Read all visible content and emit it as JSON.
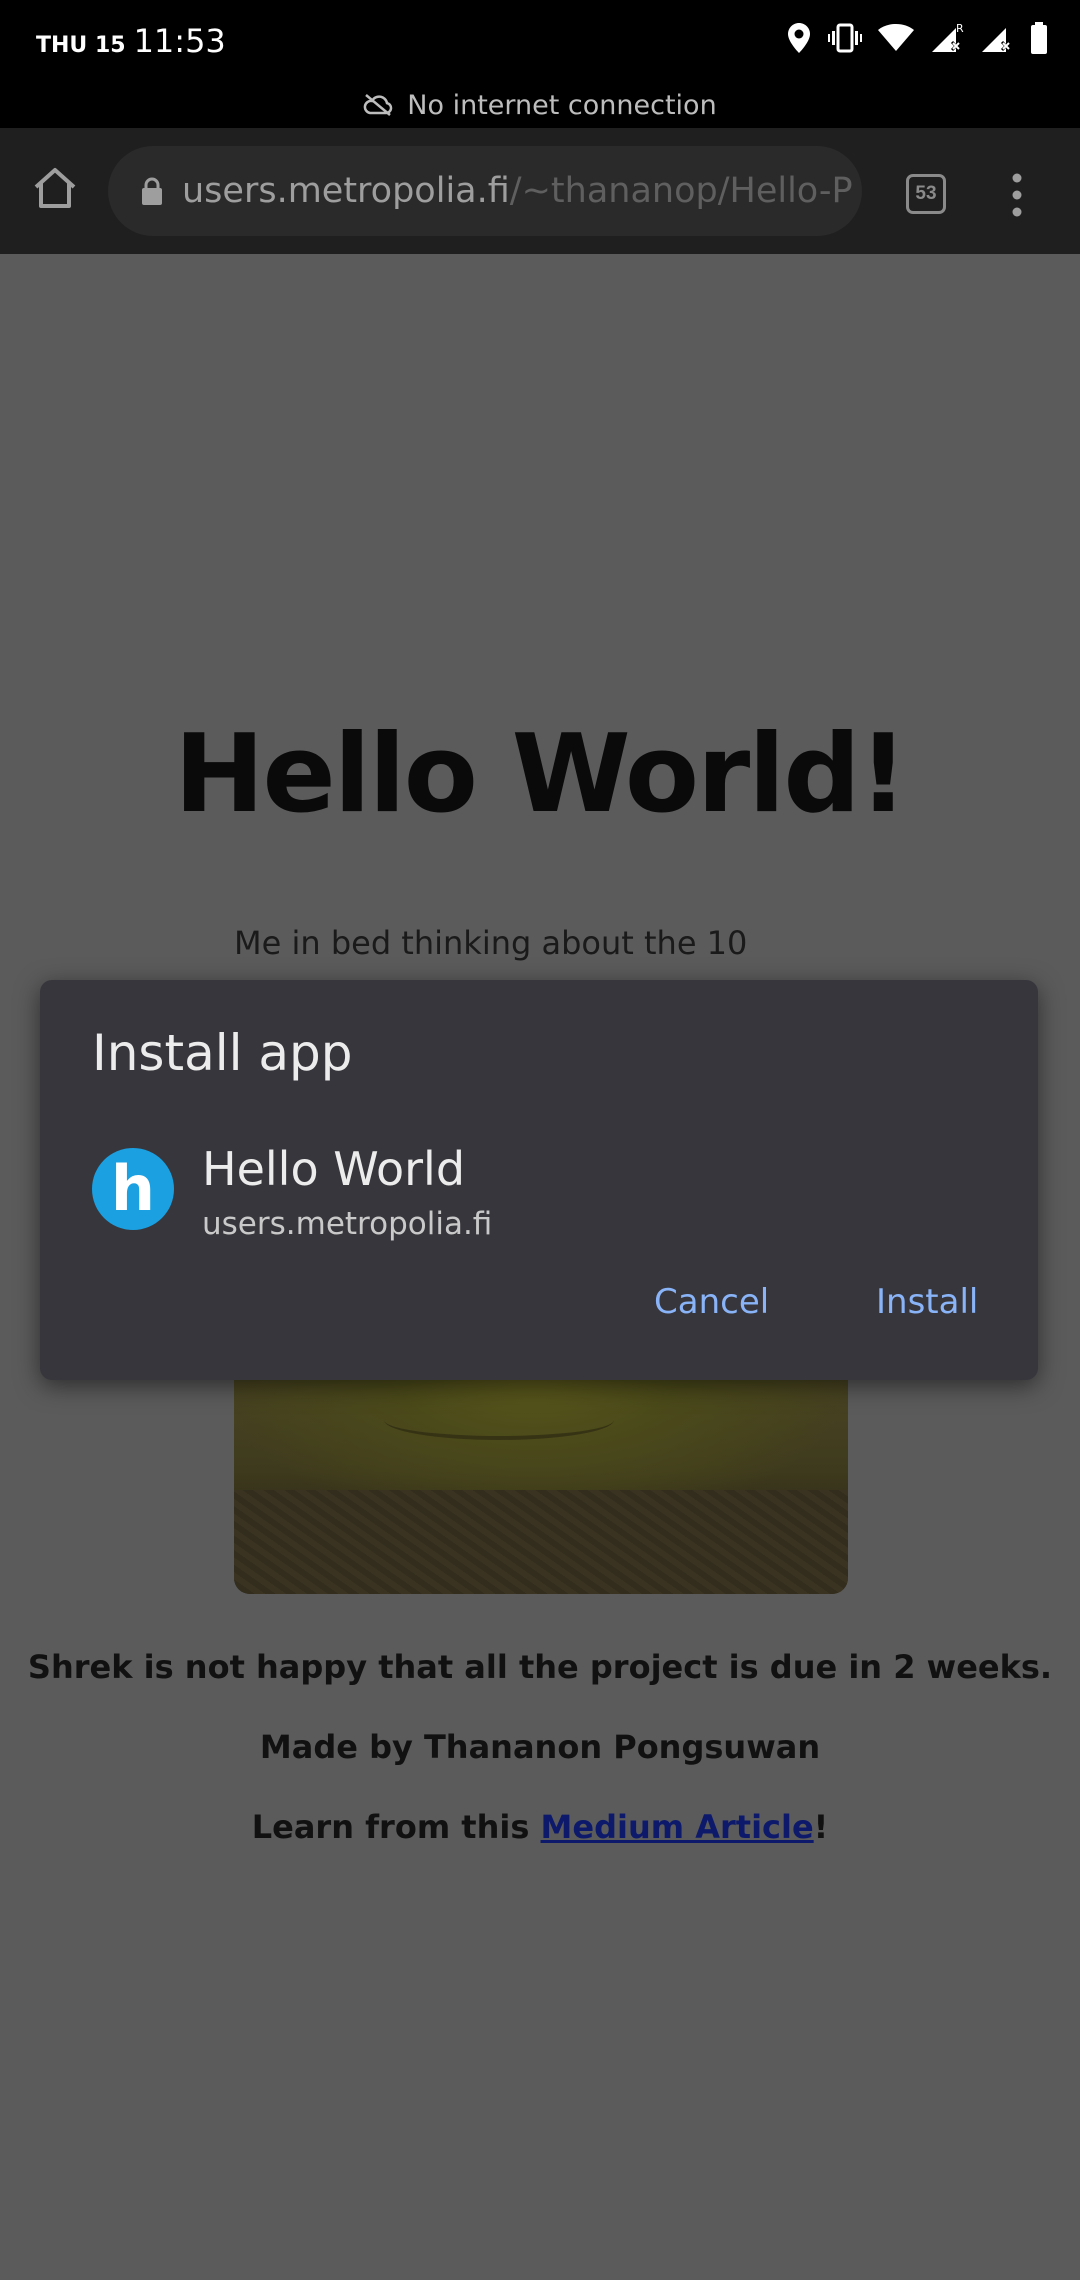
{
  "status_bar": {
    "day": "THU 15",
    "time": "11:53"
  },
  "offline_banner": {
    "text": "No internet connection",
    "icon": "cloud-off-icon"
  },
  "toolbar": {
    "home_icon": "home-icon",
    "lock_icon": "lock-icon",
    "url_host": "users.metropolia.fi",
    "url_path": "/~thananop/Hello-P",
    "tab_count": "53",
    "menu_icon": "more-vert-icon"
  },
  "page": {
    "title": "Hello World!",
    "caption": "Me in bed thinking about the 10",
    "line1": "Shrek is not happy that all the project is due in 2 weeks.",
    "line2": "Made by Thananon Pongsuwan",
    "line3_prefix": "Learn from this ",
    "line3_link": "Medium Article",
    "line3_suffix": "!"
  },
  "dialog": {
    "title": "Install app",
    "app_icon_letter": "h",
    "app_name": "Hello World",
    "app_domain": "users.metropolia.fi",
    "cancel_label": "Cancel",
    "install_label": "Install",
    "accent_color": "#8ab4f8",
    "app_icon_color": "#1ba0e1"
  }
}
